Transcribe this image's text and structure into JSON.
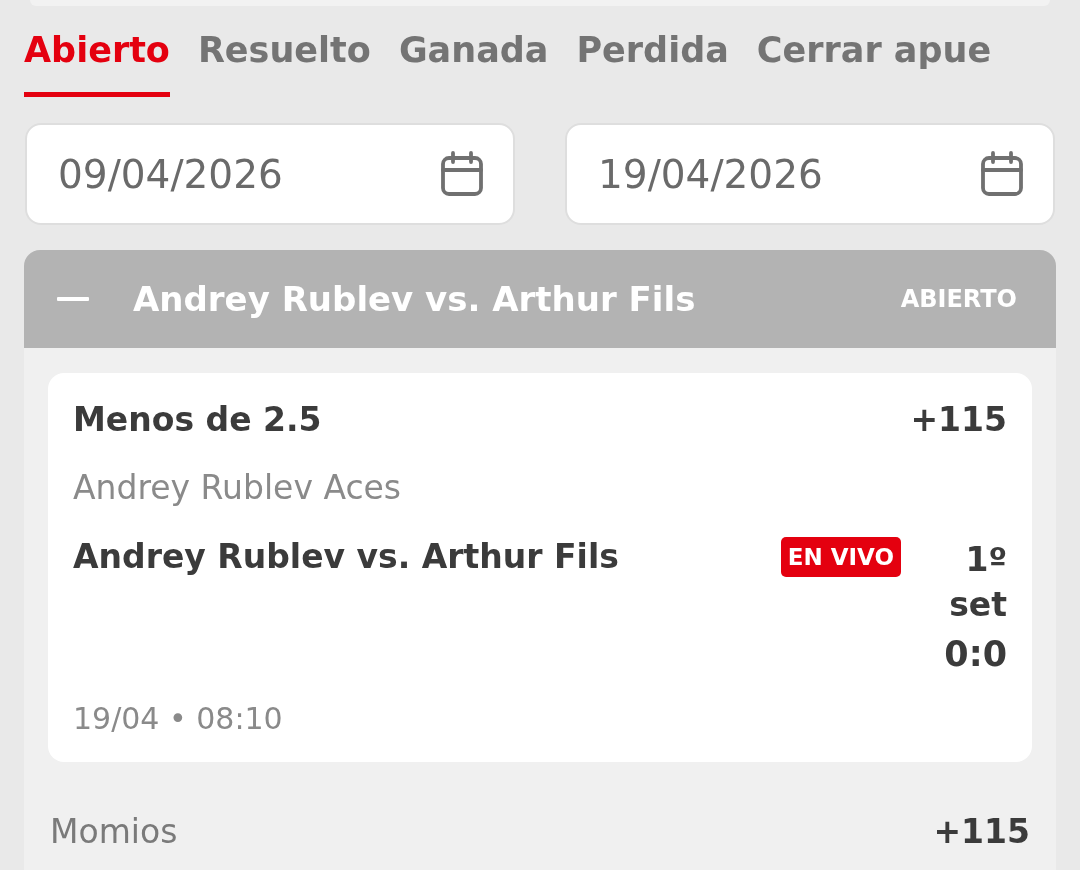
{
  "tabs": [
    {
      "label": "Abierto",
      "selected": true
    },
    {
      "label": "Resuelto",
      "selected": false
    },
    {
      "label": "Ganada",
      "selected": false
    },
    {
      "label": "Perdida",
      "selected": false
    },
    {
      "label": "Cerrar apue",
      "selected": false
    }
  ],
  "date_range": [
    {
      "value": "09/04/2026"
    },
    {
      "value": "19/04/2026"
    }
  ],
  "bet_group": {
    "title": "Andrey Rublev vs. Arthur Fils",
    "status": "ABIERTO",
    "expanded": true,
    "selections": [
      {
        "pick": "Menos de 2.5",
        "odds": "+115",
        "market": "Andrey Rublev Aces",
        "event": "Andrey Rublev vs. Arthur Fils",
        "live_badge": "EN VIVO",
        "period": "1º set",
        "score": "0:0",
        "datetime": "19/04 • 08:10"
      }
    ],
    "summary": {
      "label": "Momios",
      "value": "+115"
    }
  }
}
